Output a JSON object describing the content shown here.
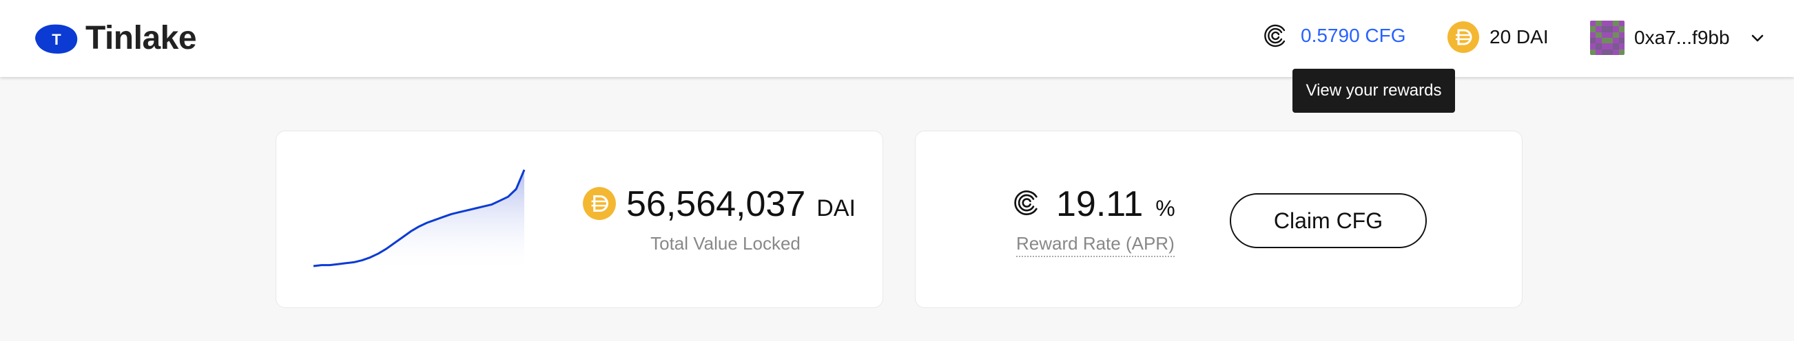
{
  "header": {
    "logo_text": "Tinlake",
    "logo_mark_letter": "T",
    "cfg_balance": "0.5790 CFG",
    "dai_balance": "20 DAI",
    "account_address": "0xa7...f9bb",
    "icons": {
      "cfg": "centrifuge-icon",
      "dai": "dai-coin-icon",
      "account_menu": "chevron-down-icon"
    }
  },
  "tooltip": {
    "text": "View your rewards"
  },
  "tvl_card": {
    "value": "56,564,037",
    "unit": "DAI",
    "label": "Total Value Locked",
    "sparkline": [
      0.0,
      0.01,
      0.01,
      0.02,
      0.03,
      0.04,
      0.06,
      0.09,
      0.13,
      0.18,
      0.24,
      0.3,
      0.36,
      0.41,
      0.45,
      0.48,
      0.51,
      0.54,
      0.56,
      0.58,
      0.6,
      0.62,
      0.64,
      0.68,
      0.72,
      0.8,
      1.0
    ]
  },
  "rewards_card": {
    "rate_value": "19.11",
    "rate_unit": "%",
    "label": "Reward Rate (APR)",
    "claim_label": "Claim CFG"
  },
  "colors": {
    "brand_blue": "#0b3bd3",
    "link_blue": "#2762ff",
    "dai_gold": "#f4b731",
    "tooltip_bg": "#1b1b1b"
  }
}
